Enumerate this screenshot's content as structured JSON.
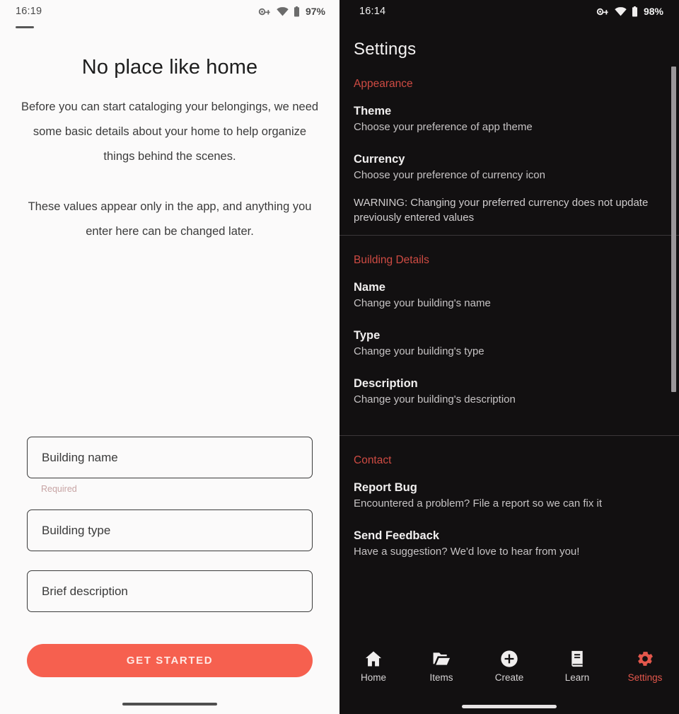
{
  "left": {
    "status": {
      "time": "16:19",
      "battery": "97%",
      "icons": [
        "vpn-key-icon",
        "wifi-icon",
        "battery-icon"
      ]
    },
    "title": "No place like home",
    "paragraph1": "Before you can start cataloging your belongings, we need some basic details about your home to help organize things behind the scenes.",
    "paragraph2": "These values appear only in the app, and anything you enter here can be changed later.",
    "fields": [
      {
        "placeholder": "Building name",
        "value": "",
        "helper": "Required"
      },
      {
        "placeholder": "Building type",
        "value": "",
        "helper": ""
      },
      {
        "placeholder": "Brief description",
        "value": "",
        "helper": ""
      }
    ],
    "cta_label": "GET STARTED",
    "accent": "#f6604f",
    "helper_color": "#c7a3a3"
  },
  "right": {
    "status": {
      "time": "16:14",
      "battery": "98%",
      "icons": [
        "vpn-key-icon",
        "wifi-icon",
        "battery-icon"
      ]
    },
    "title": "Settings",
    "accent": "#cf4b43",
    "sections": [
      {
        "heading": "Appearance",
        "rows": [
          {
            "title": "Theme",
            "subtitle": "Choose your preference of app theme"
          },
          {
            "title": "Currency",
            "subtitle": "Choose your preference of currency icon"
          }
        ],
        "note": "WARNING: Changing your preferred currency does not update previously entered values"
      },
      {
        "heading": "Building Details",
        "rows": [
          {
            "title": "Name",
            "subtitle": "Change your building's name"
          },
          {
            "title": "Type",
            "subtitle": "Change your building's type"
          },
          {
            "title": "Description",
            "subtitle": "Change your building's description"
          }
        ],
        "note": ""
      },
      {
        "heading": "Contact",
        "rows": [
          {
            "title": "Report Bug",
            "subtitle": "Encountered a problem? File a report so we can fix it"
          },
          {
            "title": "Send Feedback",
            "subtitle": "Have a suggestion? We'd love to hear from you!"
          }
        ],
        "note": ""
      }
    ],
    "nav": [
      {
        "label": "Home",
        "icon": "home-icon",
        "active": false
      },
      {
        "label": "Items",
        "icon": "folder-icon",
        "active": false
      },
      {
        "label": "Create",
        "icon": "plus-circle-icon",
        "active": false
      },
      {
        "label": "Learn",
        "icon": "book-icon",
        "active": false
      },
      {
        "label": "Settings",
        "icon": "gear-icon",
        "active": true
      }
    ]
  }
}
